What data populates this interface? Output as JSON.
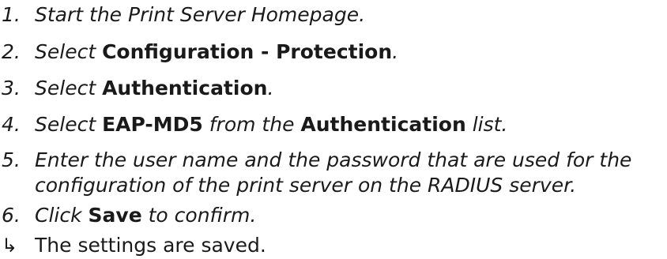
{
  "steps": [
    {
      "num": "1.",
      "parts": [
        {
          "t": "Start the Print Server Homepage.",
          "b": false
        }
      ]
    },
    {
      "num": "2.",
      "parts": [
        {
          "t": "Select ",
          "b": false
        },
        {
          "t": "Configuration - Protection",
          "b": true
        },
        {
          "t": ".",
          "b": false
        }
      ]
    },
    {
      "num": "3.",
      "parts": [
        {
          "t": "Select ",
          "b": false
        },
        {
          "t": "Authentication",
          "b": true
        },
        {
          "t": ".",
          "b": false
        }
      ]
    },
    {
      "num": "4.",
      "parts": [
        {
          "t": "Select ",
          "b": false
        },
        {
          "t": "EAP-MD5",
          "b": true
        },
        {
          "t": " from the ",
          "b": false
        },
        {
          "t": "Authentication",
          "b": true
        },
        {
          "t": " list.",
          "b": false
        }
      ]
    },
    {
      "num": "5.",
      "line1": "Enter the user name and the password that are used for the",
      "line2": "configuration of the print server on the RADIUS server."
    },
    {
      "num": "6.",
      "parts": [
        {
          "t": "Click ",
          "b": false
        },
        {
          "t": "Save",
          "b": true
        },
        {
          "t": " to confirm.",
          "b": false
        }
      ]
    }
  ],
  "result": {
    "icon": "result-arrow-icon",
    "symbol": "↳",
    "text": "The settings are saved."
  }
}
